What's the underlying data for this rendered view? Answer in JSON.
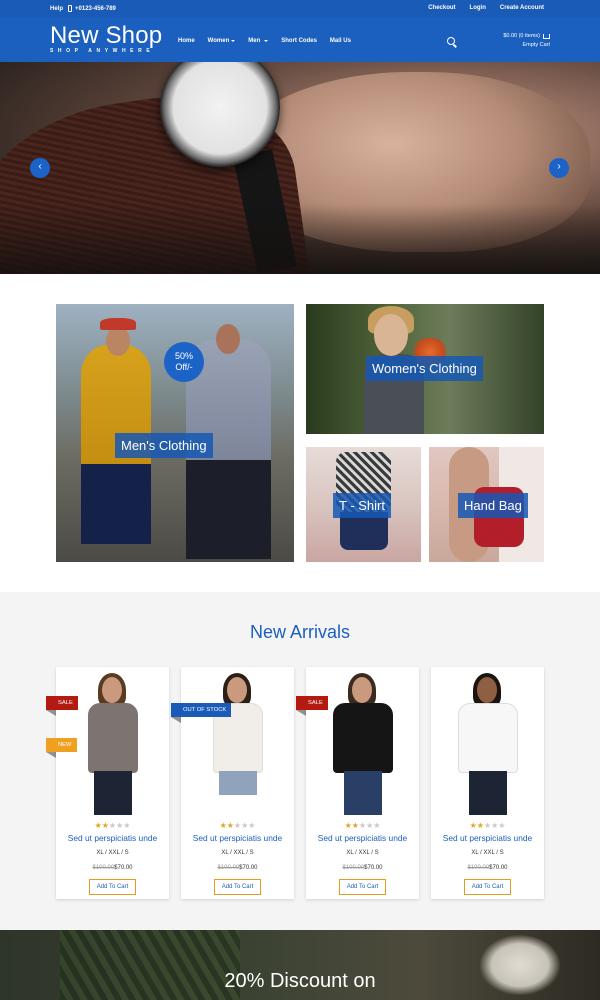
{
  "topbar": {
    "help": "Help",
    "phone": "+0123-456-789",
    "links": [
      "Checkout",
      "Login",
      "Create Account"
    ]
  },
  "header": {
    "logo_title": "New Shop",
    "logo_tagline": "SHOP ANYWHERE",
    "nav": [
      {
        "label": "Home",
        "dropdown": false
      },
      {
        "label": "Women",
        "dropdown": true
      },
      {
        "label": "Men",
        "dropdown": true
      },
      {
        "label": "Short Codes",
        "dropdown": false
      },
      {
        "label": "Mail Us",
        "dropdown": false
      }
    ],
    "cart_summary": "$0.00 (0 items)",
    "cart_status": "Empty Cart"
  },
  "hero": {
    "prev_icon": "chevron-left-icon",
    "next_icon": "chevron-right-icon",
    "prev_glyph": "‹",
    "next_glyph": "›"
  },
  "categories": {
    "mens": "Men's Clothing",
    "discount_line1": "50%",
    "discount_line2": "Off/-",
    "womens": "Women's Clothing",
    "tshirt": "T - Shirt",
    "handbag": "Hand Bag"
  },
  "arrivals": {
    "title": "New Arrivals",
    "products": [
      {
        "name": "Sed ut perspiciatis unde",
        "sizes": "XL / XXL / S",
        "old_price": "$100.00",
        "price": "$70.00",
        "button": "Add To Cart",
        "rating": 2,
        "ribbons": [
          "SALE",
          "NEW"
        ]
      },
      {
        "name": "Sed ut perspiciatis unde",
        "sizes": "XL / XXL / S",
        "old_price": "$100.00",
        "price": "$70.00",
        "button": "Add To Cart",
        "rating": 2,
        "ribbons": [
          "OUT OF STOCK"
        ]
      },
      {
        "name": "Sed ut perspiciatis unde",
        "sizes": "XL / XXL / S",
        "old_price": "$100.00",
        "price": "$70.00",
        "button": "Add To Cart",
        "rating": 2,
        "ribbons": [
          "SALE"
        ]
      },
      {
        "name": "Sed ut perspiciatis unde",
        "sizes": "XL / XXL / S",
        "old_price": "$100.00",
        "price": "$70.00",
        "button": "Add To Cart",
        "rating": 2,
        "ribbons": []
      }
    ]
  },
  "promo": {
    "text": "20% Discount on"
  },
  "colors": {
    "brand_blue": "#1b5fbf",
    "sale_red": "#b31a12",
    "new_orange": "#f0a020",
    "star_gold": "#e0a422"
  }
}
